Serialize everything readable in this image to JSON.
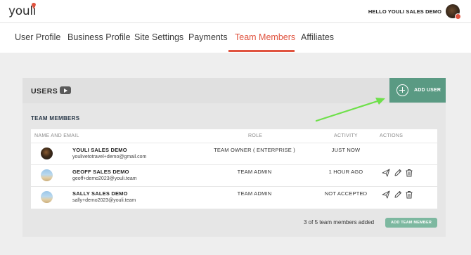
{
  "brand": {
    "logo_text": "youli",
    "accent": "#e0533f",
    "green": "#5a9a83"
  },
  "header": {
    "greeting": "HELLO YOULI SALES DEMO"
  },
  "tabs": [
    {
      "label": "User Profile",
      "active": false
    },
    {
      "label": "Business Profile",
      "active": false
    },
    {
      "label": "Site Settings",
      "active": false
    },
    {
      "label": "Payments",
      "active": false
    },
    {
      "label": "Team Members",
      "active": true
    },
    {
      "label": "Affiliates",
      "active": false
    }
  ],
  "users_panel": {
    "title": "USERS",
    "add_user_label": "ADD USER",
    "section_label": "TEAM MEMBERS",
    "columns": [
      "NAME AND EMAIL",
      "ROLE",
      "ACTIVITY",
      "ACTIONS"
    ],
    "rows": [
      {
        "name": "YOULI SALES DEMO",
        "email": "youlivetotravel+demo@gmail.com",
        "role": "TEAM OWNER ( ENTERPRISE )",
        "activity": "JUST NOW",
        "has_actions": false
      },
      {
        "name": "GEOFF SALES DEMO",
        "email": "geoff+demo2023@youli.team",
        "role": "TEAM ADMIN",
        "activity": "1 HOUR AGO",
        "has_actions": true
      },
      {
        "name": "SALLY SALES DEMO",
        "email": "sally+demo2023@youli.team",
        "role": "TEAM ADMIN",
        "activity": "NOT ACCEPTED",
        "has_actions": true
      }
    ],
    "count_text": "3 of 5 team members added",
    "add_member_label": "ADD TEAM MEMBER"
  },
  "icons": [
    "youtube-icon",
    "plus-circle-icon",
    "send-icon",
    "pencil-icon",
    "trash-icon",
    "annotation-arrow"
  ]
}
